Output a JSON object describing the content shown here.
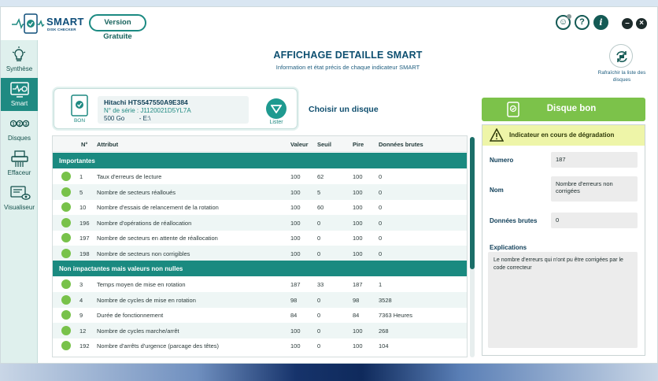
{
  "app": {
    "logo_main": "SMART",
    "logo_sub": "DISK CHECKER",
    "version_label": "Version Gratuite"
  },
  "sidebar": {
    "items": [
      {
        "label": "Synthèse",
        "icon": "lightbulb-icon"
      },
      {
        "label": "Smart",
        "icon": "monitor-check-icon"
      },
      {
        "label": "Disques",
        "icon": "numbered-disks-icon"
      },
      {
        "label": "Effaceur",
        "icon": "shredder-icon"
      },
      {
        "label": "Visualiseur",
        "icon": "viewer-eye-icon"
      }
    ]
  },
  "header": {
    "title": "AFFICHAGE DETAILLE SMART",
    "subtitle": "Information et état précis de chaque indicateur SMART",
    "refresh_label": "Rafraîchir la liste des disques"
  },
  "disk": {
    "status": "BON",
    "model": "Hitachi HTS547550A9E384",
    "serial": "N° de série : J1120021D5YL7A",
    "size": "500 Go",
    "drive": "E:\\",
    "lister_label": "Lister",
    "choose_label": "Choisir un disque"
  },
  "table": {
    "headers": [
      "N°",
      "Attribut",
      "Valeur",
      "Seuil",
      "Pire",
      "Données brutes"
    ],
    "groups": [
      {
        "title": "Importantes",
        "rows": [
          [
            "1",
            "Taux d'erreurs de lecture",
            "100",
            "62",
            "100",
            "0"
          ],
          [
            "5",
            "Nombre de secteurs réalloués",
            "100",
            "5",
            "100",
            "0"
          ],
          [
            "10",
            "Nombre d'essais de relancement de la rotation",
            "100",
            "60",
            "100",
            "0"
          ],
          [
            "196",
            "Nombre d'opérations de réallocation",
            "100",
            "0",
            "100",
            "0"
          ],
          [
            "197",
            "Nombre de secteurs en attente de réallocation",
            "100",
            "0",
            "100",
            "0"
          ],
          [
            "198",
            "Nombre de secteurs non corrigibles",
            "100",
            "0",
            "100",
            "0"
          ]
        ]
      },
      {
        "title": "Non impactantes mais valeurs non nulles",
        "rows": [
          [
            "3",
            "Temps moyen de mise en rotation",
            "187",
            "33",
            "187",
            "1"
          ],
          [
            "4",
            "Nombre de cycles de mise en rotation",
            "98",
            "0",
            "98",
            "3528"
          ],
          [
            "9",
            "Durée de fonctionnement",
            "84",
            "0",
            "84",
            "7363 Heures"
          ],
          [
            "12",
            "Nombre de cycles marche/arrêt",
            "100",
            "0",
            "100",
            "268"
          ],
          [
            "192",
            "Nombre d'arrêts d'urgence (parcage des têtes)",
            "100",
            "0",
            "100",
            "104"
          ]
        ]
      }
    ]
  },
  "detail": {
    "status_label": "Disque bon",
    "warning": "Indicateur en cours de dégradation",
    "numero_label": "Numero",
    "numero_value": "187",
    "nom_label": "Nom",
    "nom_value": "Nombre d'erreurs non corrigées",
    "brutes_label": "Données brutes",
    "brutes_value": "0",
    "expl_label": "Explications",
    "expl_value": "Le nombre d'erreurs qui n'ont pu être corrigées par le code correcteur"
  },
  "colors": {
    "accent": "#1f8a82",
    "good": "#7cc24a",
    "warning_bg": "#eef5a8",
    "title": "#0d4f70"
  }
}
